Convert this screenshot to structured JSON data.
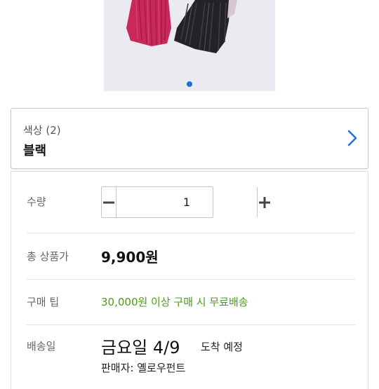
{
  "product": {
    "image_alt": "",
    "carousel": {
      "active_index": 0,
      "total": 1
    }
  },
  "option": {
    "label": "색상 (2)",
    "value": "블랙"
  },
  "details": {
    "quantity": {
      "label": "수량",
      "value": "1"
    },
    "total_price": {
      "label": "총 상품가",
      "value": "9,900원"
    },
    "purchase_tip": {
      "label": "구매 팁",
      "value": "30,000원 이상 구매 시 무료배송"
    },
    "delivery": {
      "label": "배송일",
      "date": "금요일 4/9",
      "suffix": "도착 예정",
      "seller": "판매자: 옐로우펀트"
    }
  },
  "colors": {
    "accent": "#1f73d8",
    "tip_green": "#4a9d1a"
  }
}
